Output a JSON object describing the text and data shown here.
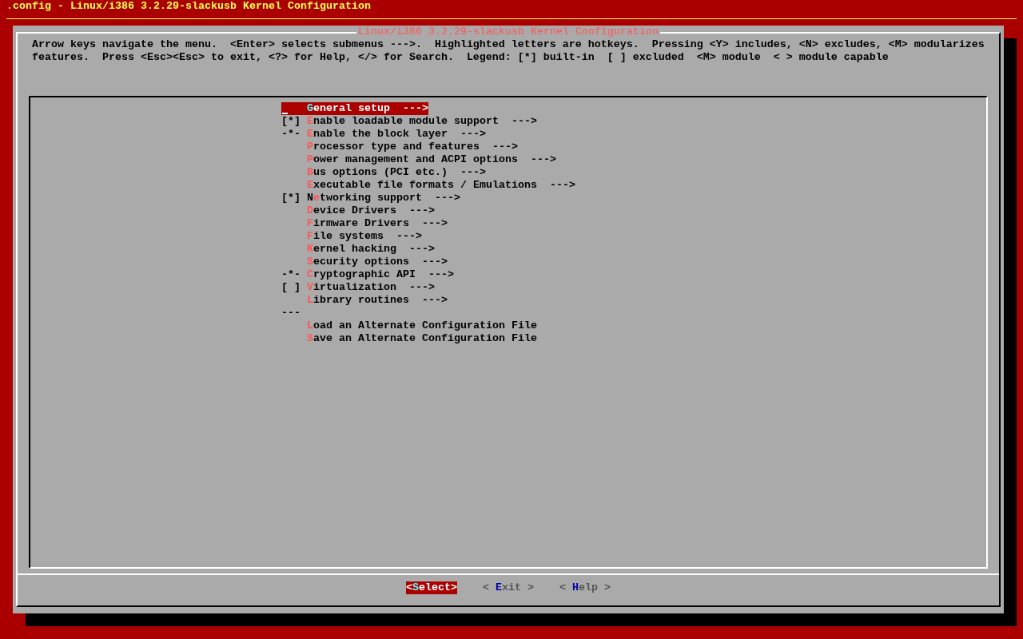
{
  "window": {
    "title": ".config - Linux/i386 3.2.29-slackusb Kernel Configuration"
  },
  "dialog": {
    "title": "Linux/i386 3.2.29-slackusb Kernel Configuration",
    "help_lines": [
      "Arrow keys navigate the menu.  <Enter> selects submenus --->.  Highlighted letters are hotkeys.  Pressing <Y> includes, <N> excludes, <M> modularizes",
      "features.  Press <Esc><Esc> to exit, <?> for Help, </> for Search.  Legend: [*] built-in  [ ] excluded  <M> module  < > module capable"
    ]
  },
  "menu": [
    {
      "kind": "entry",
      "label": "**G**eneral setup  --->",
      "selected": true
    },
    {
      "kind": "entry",
      "prefix": "[*]",
      "label": "**E**nable loadable module support  --->",
      "selected": false
    },
    {
      "kind": "entry",
      "prefix": "-*-",
      "label": "**E**nable the block layer  --->",
      "selected": false
    },
    {
      "kind": "entry",
      "label": "**P**rocessor type and features  --->",
      "selected": false
    },
    {
      "kind": "entry",
      "label": "**P**ower management and ACPI options  --->",
      "selected": false
    },
    {
      "kind": "entry",
      "label": "**B**us options (PCI etc.)  --->",
      "selected": false
    },
    {
      "kind": "entry",
      "label": "**E**xecutable file formats / Emulations  --->",
      "selected": false
    },
    {
      "kind": "entry",
      "prefix": "[*]",
      "label": "N**e**tworking support  --->",
      "selected": false
    },
    {
      "kind": "entry",
      "label": "**D**evice Drivers  --->",
      "selected": false
    },
    {
      "kind": "entry",
      "label": "**F**irmware Drivers  --->",
      "selected": false
    },
    {
      "kind": "entry",
      "label": "**F**ile systems  --->",
      "selected": false
    },
    {
      "kind": "entry",
      "label": "**K**ernel hacking  --->",
      "selected": false
    },
    {
      "kind": "entry",
      "label": "**S**ecurity options  --->",
      "selected": false
    },
    {
      "kind": "entry",
      "prefix": "-*-",
      "label": "**C**ryptographic API  --->",
      "selected": false
    },
    {
      "kind": "entry",
      "prefix": "[ ]",
      "label": "**V**irtualization  --->",
      "selected": false
    },
    {
      "kind": "entry",
      "label": "**L**ibrary routines  --->",
      "selected": false
    },
    {
      "kind": "separator",
      "label": "---"
    },
    {
      "kind": "entry",
      "label": "**L**oad an Alternate Configuration File",
      "selected": false
    },
    {
      "kind": "entry",
      "label": "**S**ave an Alternate Configuration File",
      "selected": false
    }
  ],
  "buttons": [
    {
      "label": "<**S**elect>",
      "selected": true
    },
    {
      "label": "< **E**xit >",
      "selected": false
    },
    {
      "label": "< **H**elp >",
      "selected": false
    }
  ]
}
